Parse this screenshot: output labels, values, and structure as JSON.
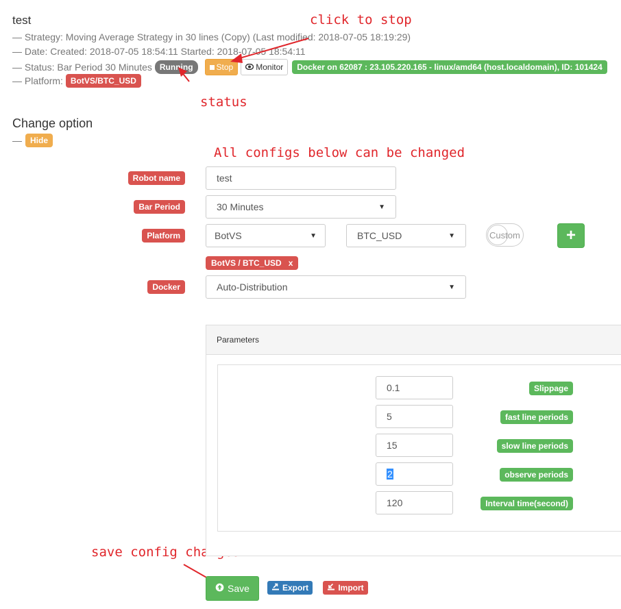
{
  "robot": {
    "name": "test",
    "strategy_line": "— Strategy: Moving Average Strategy in 30 lines (Copy)  (Last modified: 2018-07-05 18:19:29)",
    "date_line": "— Date: Created: 2018-07-05 18:54:11 Started: 2018-07-05 18:54:11",
    "status_prefix": "— Status: Bar Period 30 Minutes",
    "status_badge": "Running",
    "stop_label": "Stop",
    "monitor_label": "Monitor",
    "docker_badge": "Docker on 62087 : 23.105.220.165 - linux/amd64 (host.localdomain), ID: 101424",
    "platform_prefix": "— Platform:",
    "platform_badge": "BotVS/BTC_USD"
  },
  "annotations": {
    "click_to_stop": "click to stop",
    "status": "status",
    "all_configs": "All configs below can be changed",
    "save_changes": "save config changes"
  },
  "change_option": {
    "title": "Change option",
    "dash": "—",
    "hide_label": "Hide"
  },
  "form": {
    "robot_name_label": "Robot name",
    "robot_name_value": "test",
    "bar_period_label": "Bar Period",
    "bar_period_value": "30 Minutes",
    "platform_label": "Platform",
    "platform_exchange": "BotVS",
    "platform_pair": "BTC_USD",
    "custom_label": "Custom",
    "add_label": "+",
    "selected_platform_tag": "BotVS / BTC_USD",
    "remove_tag": "x",
    "docker_label": "Docker",
    "docker_value": "Auto-Distribution"
  },
  "parameters": {
    "title": "Parameters",
    "items": [
      {
        "label": "Slippage",
        "value": "0.1"
      },
      {
        "label": "fast line periods",
        "value": "5"
      },
      {
        "label": "slow line periods",
        "value": "15"
      },
      {
        "label": "observe periods",
        "value": "2"
      },
      {
        "label": "Interval time(second)",
        "value": "120"
      }
    ]
  },
  "actions": {
    "save_label": "Save",
    "export_label": "Export",
    "import_label": "Import"
  },
  "colors": {
    "accent_red": "#d9534f",
    "accent_green": "#5cb85c",
    "accent_orange": "#f0ad4e",
    "accent_blue": "#337ab7",
    "annotation_red": "#e0262b"
  }
}
